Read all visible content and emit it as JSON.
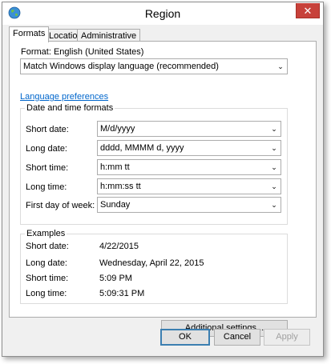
{
  "window": {
    "title": "Region"
  },
  "tabs": [
    {
      "label": "Formats",
      "active": true
    },
    {
      "label": "Location",
      "active": false
    },
    {
      "label": "Administrative",
      "active": false
    }
  ],
  "format": {
    "label": "Format: English (United States)",
    "selected": "Match Windows display language (recommended)"
  },
  "language_preferences_link": "Language preferences",
  "date_time_formats": {
    "title": "Date and time formats",
    "rows": [
      {
        "label": "Short date:",
        "value": "M/d/yyyy"
      },
      {
        "label": "Long date:",
        "value": "dddd, MMMM d, yyyy"
      },
      {
        "label": "Short time:",
        "value": "h:mm tt"
      },
      {
        "label": "Long time:",
        "value": "h:mm:ss tt"
      },
      {
        "label": "First day of week:",
        "value": "Sunday"
      }
    ]
  },
  "examples": {
    "title": "Examples",
    "rows": [
      {
        "label": "Short date:",
        "value": "4/22/2015"
      },
      {
        "label": "Long date:",
        "value": "Wednesday, April 22, 2015"
      },
      {
        "label": "Short time:",
        "value": "5:09 PM"
      },
      {
        "label": "Long time:",
        "value": "5:09:31 PM"
      }
    ]
  },
  "buttons": {
    "additional_settings": "Additional settings...",
    "ok": "OK",
    "cancel": "Cancel",
    "apply": "Apply"
  },
  "icons": {
    "app": "globe-icon",
    "close": "close-icon",
    "dropdown": "chevron-down-icon"
  },
  "colors": {
    "close_button": "#c7413a",
    "link": "#0066cc",
    "dialog_bg": "#f0f0f0"
  }
}
